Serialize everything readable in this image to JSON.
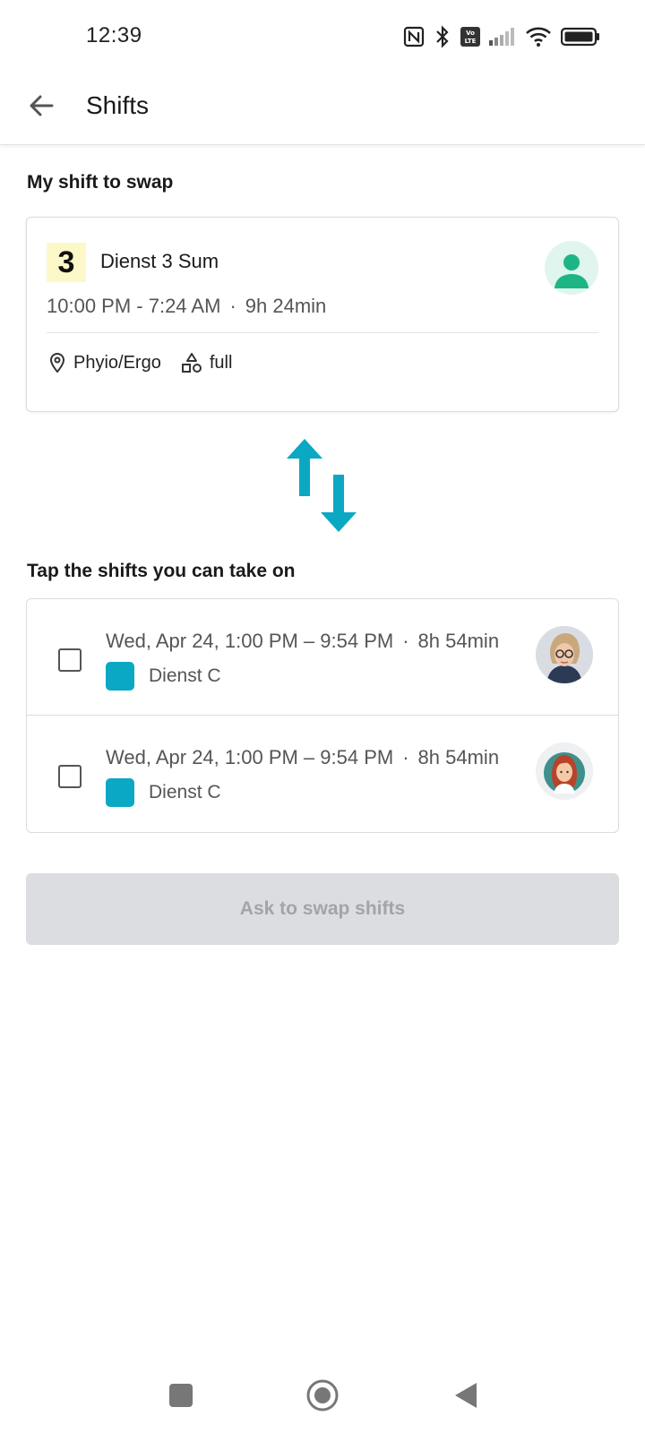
{
  "status_bar": {
    "time": "12:39",
    "icons": [
      "nfc-icon",
      "bluetooth-icon",
      "volte-icon",
      "signal-icon",
      "wifi-icon",
      "battery-icon"
    ]
  },
  "app_bar": {
    "title": "Shifts",
    "back_icon": "arrow-left-icon"
  },
  "my_shift": {
    "section_label": "My shift to swap",
    "badge": "3",
    "name": "Dienst 3 Sum",
    "time_range": "10:00 PM - 7:24 AM",
    "separator": "·",
    "duration": "9h 24min",
    "location": "Phyio/Ergo",
    "shape_label": "full",
    "badge_color": "#fdf8c8",
    "avatar_color": "#1db586"
  },
  "swap_icon_color": "#0aa8c3",
  "candidates": {
    "section_label": "Tap the shifts you can take on",
    "items": [
      {
        "time_range": "Wed, Apr 24, 1:00 PM – 9:54 PM",
        "separator": "·",
        "duration": "8h 54min",
        "shift_name": "Dienst C",
        "color": "#0aa8c3",
        "checked": false
      },
      {
        "time_range": "Wed, Apr 24, 1:00 PM – 9:54 PM",
        "separator": "·",
        "duration": "8h 54min",
        "shift_name": "Dienst C",
        "color": "#0aa8c3",
        "checked": false
      }
    ]
  },
  "action": {
    "label": "Ask to swap shifts",
    "enabled": false
  },
  "nav_bar": {
    "icons": [
      "recents-square-icon",
      "home-circle-icon",
      "back-triangle-icon"
    ]
  }
}
